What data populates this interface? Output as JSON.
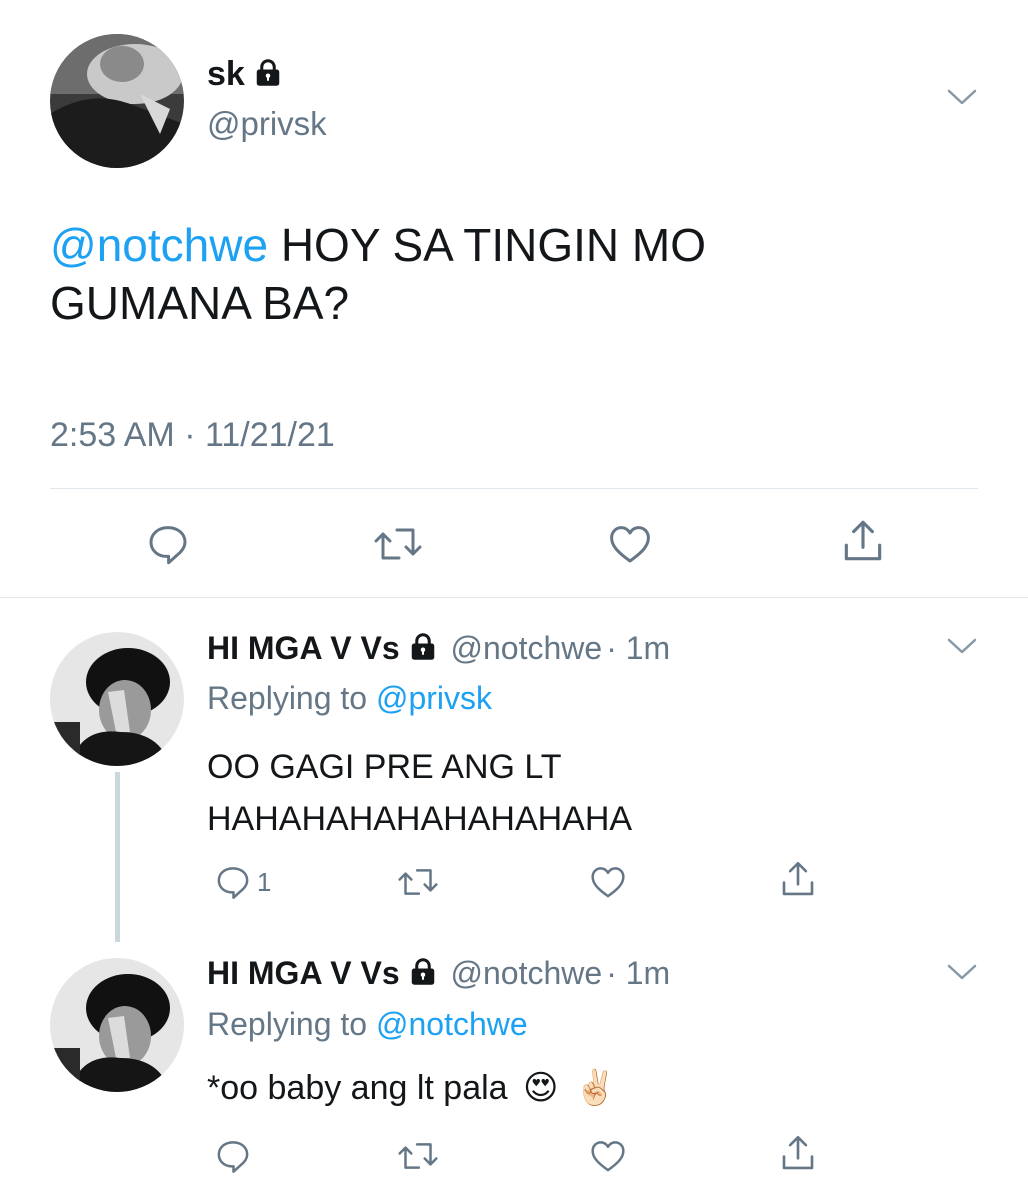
{
  "main_tweet": {
    "display_name": "sk",
    "handle": "@privsk",
    "mention": "@notchwe",
    "text_line1": "HOY SA TINGIN MO",
    "text_line2": "GUMANA BA?",
    "timestamp": "2:53 AM · 11/21/21"
  },
  "replies": [
    {
      "display_name": "HI MGA V Vs",
      "handle": "@notchwe",
      "time": "· 1m",
      "replying_prefix": "Replying to",
      "replying_to": "@privsk",
      "text_line1": "OO GAGI PRE ANG LT",
      "text_line2": "HAHAHAHAHAHAHAHAHA",
      "reply_count": "1"
    },
    {
      "display_name": "HI MGA V Vs",
      "handle": "@notchwe",
      "time": "· 1m",
      "replying_prefix": "Replying to",
      "replying_to": "@notchwe",
      "text": "*oo baby ang lt pala",
      "emoji_1": "😍",
      "emoji_2": "✌🏻",
      "reply_count": ""
    }
  ],
  "colors": {
    "link": "#1da1f2",
    "secondary": "#657786",
    "divider": "#e1e8ed",
    "thread_line": "#ccd6dd"
  },
  "icons": [
    "lock-icon",
    "chevron-down-icon",
    "reply-icon",
    "retweet-icon",
    "like-icon",
    "share-icon"
  ]
}
